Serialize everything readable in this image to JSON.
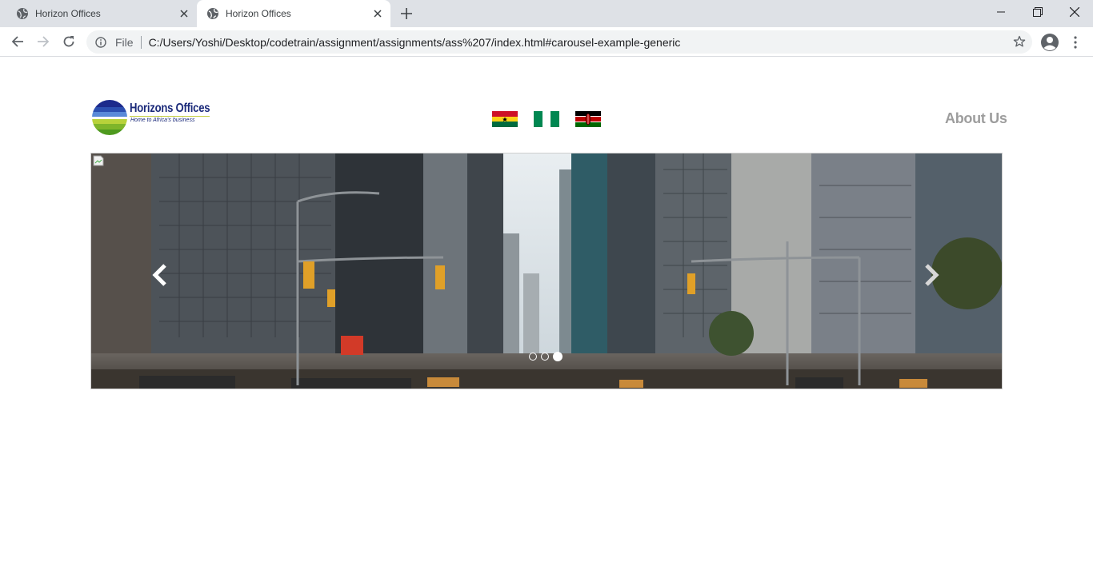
{
  "browser": {
    "tabs": [
      {
        "title": "Horizon Offices",
        "active": false
      },
      {
        "title": "Horizon Offices",
        "active": true
      }
    ],
    "address": {
      "scheme_label": "File",
      "url": "C:/Users/Yoshi/Desktop/codetrain/assignment/assignments/ass%207/index.html#carousel-example-generic"
    },
    "icons": [
      "globe-icon",
      "close-icon",
      "plus-icon",
      "minimize-icon",
      "restore-icon",
      "close-window-icon",
      "back-icon",
      "forward-icon",
      "reload-icon",
      "info-icon",
      "star-icon",
      "profile-icon",
      "menu-icon"
    ]
  },
  "site": {
    "logo": {
      "name": "Horizons Offices",
      "tagline": "Home to Africa's business"
    },
    "flags": [
      "ghana-flag",
      "nigeria-flag",
      "kenya-flag"
    ],
    "nav": {
      "about_label": "About Us"
    },
    "carousel": {
      "slide_count": 3,
      "active_index": 2,
      "controls": [
        "chevron-left-icon",
        "chevron-right-icon"
      ]
    }
  },
  "colors": {
    "tabstrip": "#dee1e6",
    "omnibox": "#f1f3f4",
    "about_text": "#9d9d9d",
    "logo_blue": "#1b2a7a"
  }
}
